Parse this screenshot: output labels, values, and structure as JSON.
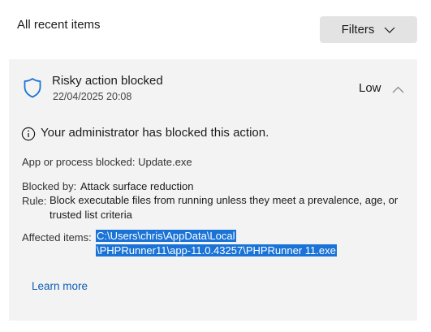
{
  "header": {
    "title": "All recent items",
    "filters_label": "Filters"
  },
  "event": {
    "title": "Risky action blocked",
    "timestamp": "22/04/2025 20:08",
    "severity": "Low",
    "info_message": "Your administrator has blocked this action.",
    "app_line": "App or process blocked: Update.exe",
    "blocked_by_label": "Blocked by:",
    "blocked_by_value": "Attack surface reduction",
    "rule_label": "Rule:",
    "rule_value": "Block executable files from running unless they meet a prevalence, age, or trusted list criteria",
    "affected_label": "Affected items:",
    "affected_line1": "C:\\Users\\chris\\AppData\\Local",
    "affected_line2": "\\PHPRunner11\\app-11.0.43257\\PHPRunner 11.exe",
    "learn_more": "Learn more"
  },
  "colors": {
    "accent": "#0f5fb5",
    "highlight": "#1a73d6",
    "card_bg": "#f3f3f3",
    "button_bg": "#e3e3e3"
  },
  "icons": {
    "shield": "shield-icon",
    "filter_chevron": "chevron-down-icon",
    "collapse": "chevron-up-icon",
    "info": "info-icon"
  }
}
